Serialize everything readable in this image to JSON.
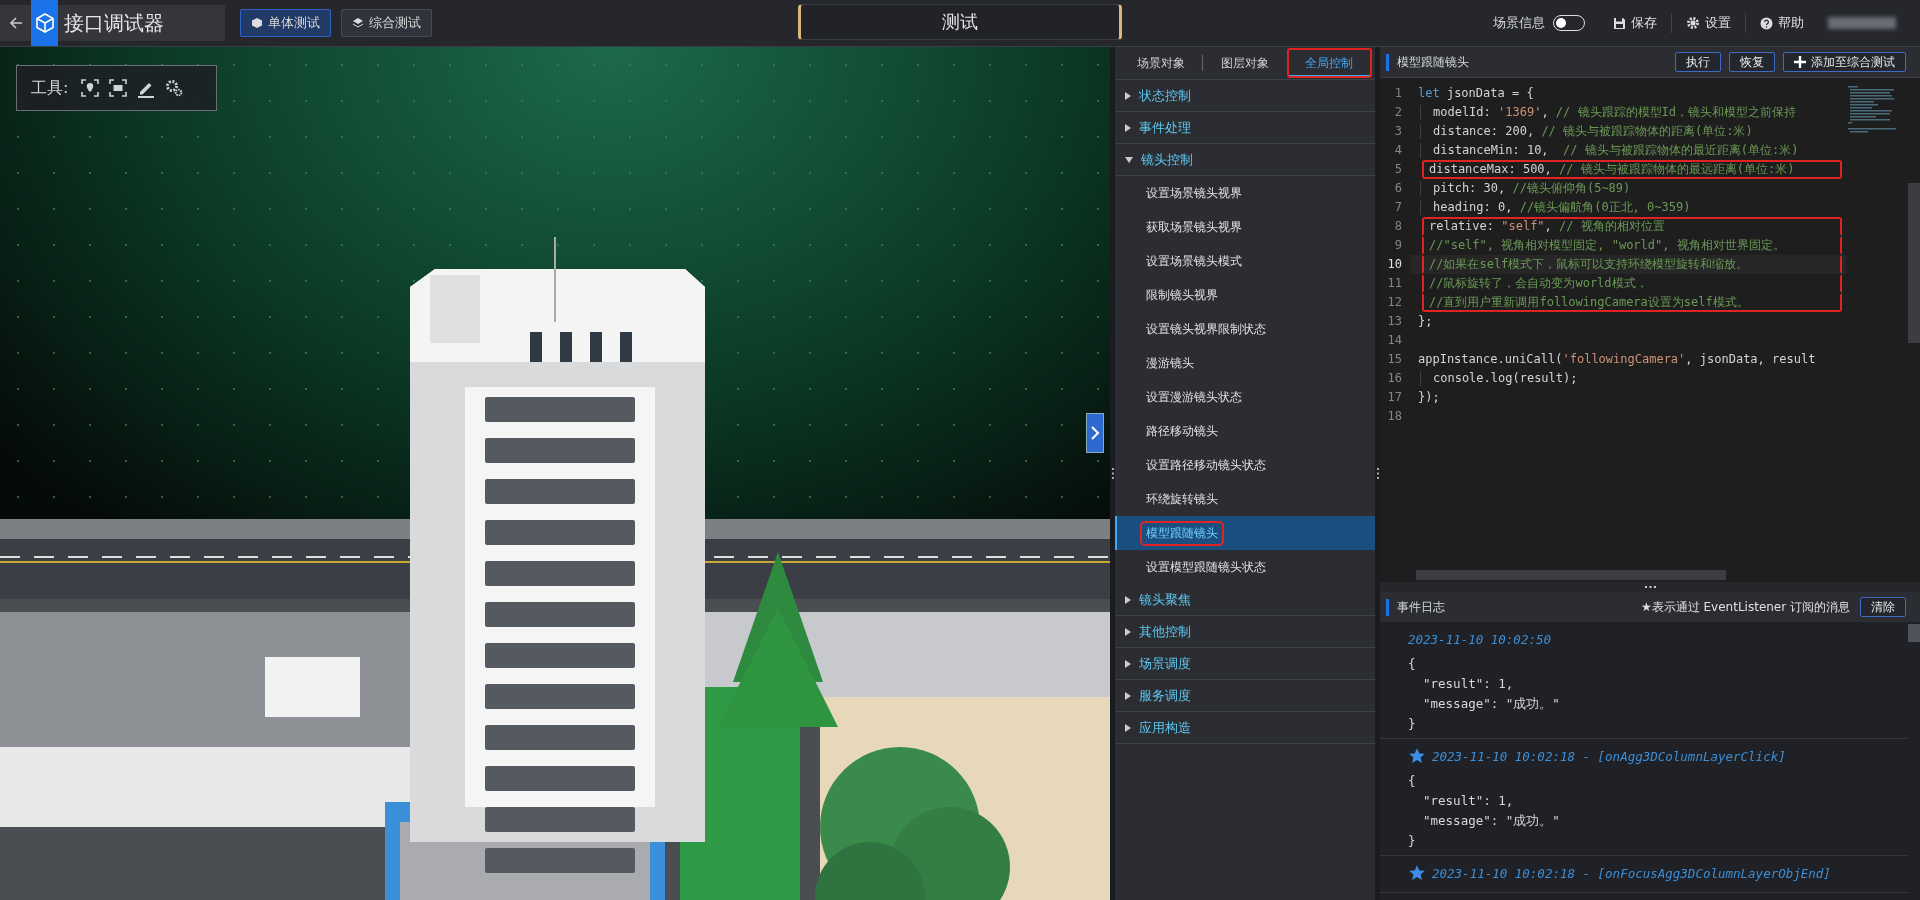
{
  "top_bar": {
    "app_title": "接口调试器",
    "mode_buttons": [
      {
        "label": "单体测试",
        "selected": true
      },
      {
        "label": "综合测试",
        "selected": false
      }
    ],
    "center_title": "测试",
    "scene_info": {
      "label": "场景信息",
      "on": false
    },
    "actions": [
      {
        "kind": "save",
        "label": "保存"
      },
      {
        "kind": "settings",
        "label": "设置"
      },
      {
        "kind": "help",
        "label": "帮助"
      }
    ]
  },
  "viewport": {
    "toolbar_label": "工具:"
  },
  "panel": {
    "tabs": [
      {
        "label": "场景对象",
        "selected": false,
        "highlighted": false
      },
      {
        "label": "图层对象",
        "selected": false,
        "highlighted": false
      },
      {
        "label": "全局控制",
        "selected": true,
        "highlighted": true
      }
    ],
    "tree": [
      {
        "label": "状态控制",
        "expanded": false
      },
      {
        "label": "事件处理",
        "expanded": false
      },
      {
        "label": "镜头控制",
        "expanded": true,
        "children": [
          {
            "label": "设置场景镜头视界",
            "selected": false,
            "highlighted": false
          },
          {
            "label": "获取场景镜头视界",
            "selected": false,
            "highlighted": false
          },
          {
            "label": "设置场景镜头模式",
            "selected": false,
            "highlighted": false
          },
          {
            "label": "限制镜头视界",
            "selected": false,
            "highlighted": false
          },
          {
            "label": "设置镜头视界限制状态",
            "selected": false,
            "highlighted": false
          },
          {
            "label": "漫游镜头",
            "selected": false,
            "highlighted": false
          },
          {
            "label": "设置漫游镜头状态",
            "selected": false,
            "highlighted": false
          },
          {
            "label": "路径移动镜头",
            "selected": false,
            "highlighted": false
          },
          {
            "label": "设置路径移动镜头状态",
            "selected": false,
            "highlighted": false
          },
          {
            "label": "环绕旋转镜头",
            "selected": false,
            "highlighted": false
          },
          {
            "label": "模型跟随镜头",
            "selected": true,
            "highlighted": true
          },
          {
            "label": "设置模型跟随镜头状态",
            "selected": false,
            "highlighted": false
          }
        ]
      },
      {
        "label": "镜头聚焦",
        "expanded": false
      },
      {
        "label": "其他控制",
        "expanded": false
      },
      {
        "label": "场景调度",
        "expanded": false
      },
      {
        "label": "服务调度",
        "expanded": false
      },
      {
        "label": "应用构造",
        "expanded": false
      }
    ]
  },
  "editor": {
    "title": "模型跟随镜头",
    "buttons": [
      {
        "kind": "plain",
        "label": "执行"
      },
      {
        "kind": "plain",
        "label": "恢复"
      },
      {
        "kind": "add",
        "label": "添加至综合测试"
      }
    ],
    "lines": [
      {
        "number": "1",
        "indented": false,
        "current": false,
        "boxed": false,
        "tokens": [
          {
            "kind": "keyword",
            "text": "let"
          },
          {
            "kind": "plain",
            "text": " jsonData = {"
          }
        ]
      },
      {
        "number": "2",
        "indented": true,
        "current": false,
        "boxed": false,
        "tokens": [
          {
            "kind": "plain",
            "text": "modelId: "
          },
          {
            "kind": "string",
            "text": "'1369'"
          },
          {
            "kind": "plain",
            "text": ", "
          },
          {
            "kind": "comment",
            "text": "// 镜头跟踪的模型Id，镜头和模型之前保持"
          }
        ]
      },
      {
        "number": "3",
        "indented": true,
        "current": false,
        "boxed": false,
        "tokens": [
          {
            "kind": "plain",
            "text": "distance: 200, "
          },
          {
            "kind": "comment",
            "text": "// 镜头与被跟踪物体的距离(单位:米)"
          }
        ]
      },
      {
        "number": "4",
        "indented": true,
        "current": false,
        "boxed": false,
        "tokens": [
          {
            "kind": "plain",
            "text": "distanceMin: 10,  "
          },
          {
            "kind": "comment",
            "text": "// 镜头与被跟踪物体的最近距离(单位:米)"
          }
        ]
      },
      {
        "number": "5",
        "indented": true,
        "current": false,
        "boxed": true,
        "tokens": [
          {
            "kind": "plain",
            "text": "distanceMax: 500, "
          },
          {
            "kind": "comment",
            "text": "// 镜头与被跟踪物体的最远距离(单位:米)"
          }
        ]
      },
      {
        "number": "6",
        "indented": true,
        "current": false,
        "boxed": false,
        "tokens": [
          {
            "kind": "plain",
            "text": "pitch: 30, "
          },
          {
            "kind": "comment",
            "text": "//镜头俯仰角(5~89)"
          }
        ]
      },
      {
        "number": "7",
        "indented": true,
        "current": false,
        "boxed": false,
        "tokens": [
          {
            "kind": "plain",
            "text": "heading: 0, "
          },
          {
            "kind": "comment",
            "text": "//镜头偏航角(0正北, 0~359)"
          }
        ]
      },
      {
        "number": "8",
        "indented": true,
        "current": false,
        "boxed": true,
        "tokens": [
          {
            "kind": "plain",
            "text": "relative: "
          },
          {
            "kind": "string",
            "text": "\"self\""
          },
          {
            "kind": "plain",
            "text": ", "
          },
          {
            "kind": "comment",
            "text": "// 视角的相对位置"
          }
        ]
      },
      {
        "number": "9",
        "indented": true,
        "current": false,
        "boxed": true,
        "tokens": [
          {
            "kind": "comment",
            "text": "//\"self\", 视角相对模型固定, \"world\", 视角相对世界固定。"
          }
        ]
      },
      {
        "number": "10",
        "indented": true,
        "current": true,
        "boxed": true,
        "tokens": [
          {
            "kind": "comment",
            "text": "//如果在self模式下，鼠标可以支持环绕模型旋转和缩放。"
          }
        ]
      },
      {
        "number": "11",
        "indented": true,
        "current": false,
        "boxed": true,
        "tokens": [
          {
            "kind": "comment",
            "text": "//鼠标旋转了，会自动变为world模式，"
          }
        ]
      },
      {
        "number": "12",
        "indented": true,
        "current": false,
        "boxed": true,
        "tokens": [
          {
            "kind": "comment",
            "text": "//直到用户重新调用followingCamera设置为self模式。"
          }
        ]
      },
      {
        "number": "13",
        "indented": false,
        "current": false,
        "boxed": false,
        "tokens": [
          {
            "kind": "plain",
            "text": "};"
          }
        ]
      },
      {
        "number": "14",
        "indented": false,
        "current": false,
        "boxed": false
      },
      {
        "number": "15",
        "indented": false,
        "current": false,
        "boxed": false,
        "tokens": [
          {
            "kind": "plain",
            "text": "appInstance.uniCall("
          },
          {
            "kind": "string",
            "text": "'followingCamera'"
          },
          {
            "kind": "plain",
            "text": ", jsonData, result"
          }
        ]
      },
      {
        "number": "16",
        "indented": true,
        "current": false,
        "boxed": false,
        "tokens": [
          {
            "kind": "plain",
            "text": "console.log(result);"
          }
        ]
      },
      {
        "number": "17",
        "indented": false,
        "current": false,
        "boxed": false,
        "tokens": [
          {
            "kind": "plain",
            "text": "});"
          }
        ]
      },
      {
        "number": "18",
        "indented": false,
        "current": false,
        "boxed": false
      }
    ]
  },
  "event_log": {
    "title": "事件日志",
    "note": "★表示通过 EventListener 订阅的消息",
    "clear_button": "清除",
    "entries": [
      {
        "starred": false,
        "header": "2023-11-10 10:02:50",
        "body": [
          {
            "text": "{",
            "indented": false
          },
          {
            "text": "\"result\": 1,",
            "indented": true
          },
          {
            "text": "\"message\": \"成功。\"",
            "indented": true
          },
          {
            "text": "}",
            "indented": false
          }
        ]
      },
      {
        "starred": true,
        "header": "2023-11-10 10:02:18 - [onAgg3DColumnLayerClick]",
        "body": [
          {
            "text": "{",
            "indented": false
          },
          {
            "text": "\"result\": 1,",
            "indented": true
          },
          {
            "text": "\"message\": \"成功。\"",
            "indented": true
          },
          {
            "text": "}",
            "indented": false
          }
        ]
      },
      {
        "starred": true,
        "header": "2023-11-10 10:02:18 - [onFocusAgg3DColumnLayerObjEnd]"
      }
    ]
  }
}
